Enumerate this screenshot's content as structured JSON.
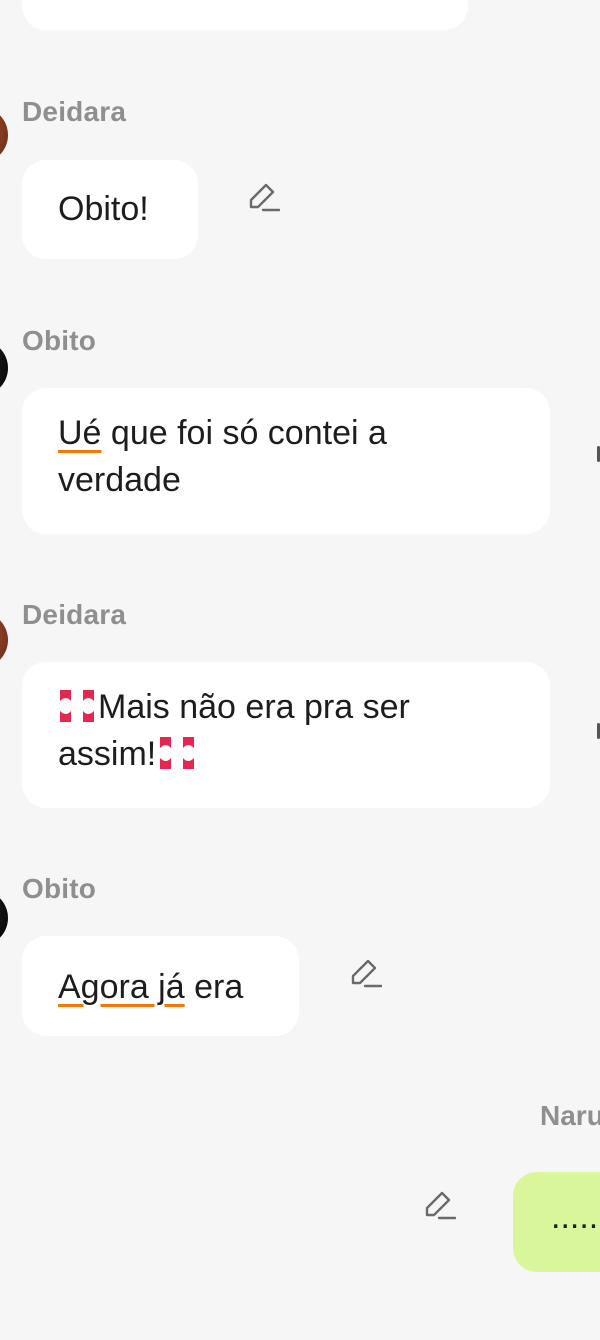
{
  "messages": [
    {
      "sender": "Deidara",
      "text": "Obito!"
    },
    {
      "sender": "Obito",
      "text_underlined": "Ué",
      "text_rest": " que foi só contei a verdade"
    },
    {
      "sender": "Deidara",
      "text_main": "Mais não era pra ser assim!",
      "emoji": "anger-symbol"
    },
    {
      "sender": "Obito",
      "text_underlined": "Agora já",
      "text_rest": " era"
    }
  ],
  "user_message": {
    "sender": "Naru",
    "text": "....."
  },
  "colors": {
    "background": "#f6f6f6",
    "bubble": "#ffffff",
    "user_bubble": "#d9f79a",
    "sender_name": "#8f8f8f",
    "spellcheck_underline": "#f07b00"
  },
  "icons": {
    "edit": "pencil-icon",
    "avatar_deidara": "avatar-deidara",
    "avatar_obito": "avatar-obito"
  }
}
